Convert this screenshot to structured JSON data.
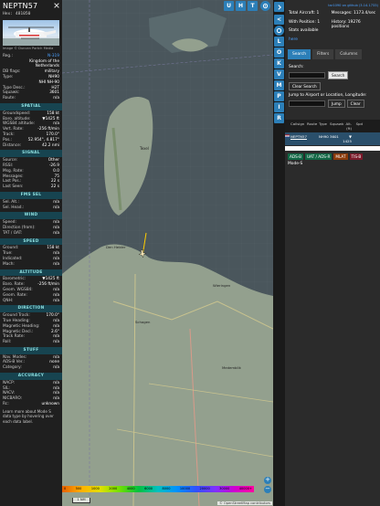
{
  "left": {
    "callsign": "NEPTN57",
    "hex_label": "Hex: 481050",
    "photo_credit": "Image © Duncan Portch Media",
    "rows1": [
      {
        "k": "Reg.:",
        "v": "N-319",
        "link": true
      },
      {
        "k": "",
        "v": "Kingdom of the Netherlands",
        "link": false
      },
      {
        "k": "DB flags:",
        "v": "military",
        "link": false
      },
      {
        "k": "Type:",
        "v": "NH90",
        "link": false
      },
      {
        "k": "",
        "v": "NHI NH-90",
        "link": false
      },
      {
        "k": "Type Desc.:",
        "v": "H2T",
        "link": false
      },
      {
        "k": "Squawk:",
        "v": "3601",
        "link": false
      },
      {
        "k": "Route:",
        "v": "n/a",
        "link": false
      }
    ],
    "sections": [
      {
        "title": "SPATIAL",
        "rows": [
          {
            "k": "Groundspeed:",
            "v": "158 kt"
          },
          {
            "k": "Baro. altitude:",
            "v": "▼1425 ft"
          },
          {
            "k": "WGS84 altitude:",
            "v": "n/a"
          },
          {
            "k": "Vert. Rate:",
            "v": "-256 ft/min"
          },
          {
            "k": "Track:",
            "v": "170.0°"
          },
          {
            "k": "Pos.:",
            "v": "52.954°, 4.817°"
          },
          {
            "k": "Distance:",
            "v": "42.2 nmi"
          }
        ]
      },
      {
        "title": "SIGNAL",
        "rows": [
          {
            "k": "Source:",
            "v": "Other"
          },
          {
            "k": "RSSI:",
            "v": "-26.9"
          },
          {
            "k": "Msg. Rate:",
            "v": "0.0"
          },
          {
            "k": "Messages:",
            "v": "75"
          },
          {
            "k": "Last Pos.:",
            "v": "22 s"
          },
          {
            "k": "Last Seen:",
            "v": "22 s"
          }
        ]
      },
      {
        "title": "FMS SEL",
        "rows": [
          {
            "k": "Sel. Alt.:",
            "v": "n/a"
          },
          {
            "k": "Sel. Head.:",
            "v": "n/a"
          }
        ]
      },
      {
        "title": "WIND",
        "rows": [
          {
            "k": "Speed:",
            "v": "n/a"
          },
          {
            "k": "Direction (from):",
            "v": "n/a"
          },
          {
            "k": "TAT / OAT:",
            "v": "n/a"
          }
        ]
      },
      {
        "title": "SPEED",
        "rows": [
          {
            "k": "Ground:",
            "v": "158 kt"
          },
          {
            "k": "True:",
            "v": "n/a"
          },
          {
            "k": "Indicated:",
            "v": "n/a"
          },
          {
            "k": "Mach:",
            "v": "n/a"
          }
        ]
      },
      {
        "title": "ALTITUDE",
        "rows": [
          {
            "k": "Barometric:",
            "v": "▼1425 ft"
          },
          {
            "k": "Baro. Rate:",
            "v": "-256 ft/min"
          },
          {
            "k": "Geom. WGS84:",
            "v": "n/a"
          },
          {
            "k": "Geom. Rate:",
            "v": "n/a"
          },
          {
            "k": "QNH:",
            "v": "n/a"
          }
        ]
      },
      {
        "title": "DIRECTION",
        "rows": [
          {
            "k": "Ground Track:",
            "v": "170.0°"
          },
          {
            "k": "True Heading:",
            "v": "n/a"
          },
          {
            "k": "Magnetic Heading:",
            "v": "n/a"
          },
          {
            "k": "Magnetic Decl.:",
            "v": "2.6°"
          },
          {
            "k": "Track Rate:",
            "v": "n/a"
          },
          {
            "k": "Roll:",
            "v": "n/a"
          }
        ]
      },
      {
        "title": "STUFF",
        "rows": [
          {
            "k": "Nav. Modes:",
            "v": "n/a"
          },
          {
            "k": "ADS-B Ver.:",
            "v": "none"
          },
          {
            "k": "Category:",
            "v": "n/a"
          }
        ]
      },
      {
        "title": "ACCURACY",
        "rows": [
          {
            "k": "NACP:",
            "v": "n/a"
          },
          {
            "k": "SIL:",
            "v": "n/a"
          },
          {
            "k": "NACV:",
            "v": "n/a"
          },
          {
            "k": "NICBARO:",
            "v": "n/a"
          },
          {
            "k": "Rc:",
            "v": "unknown"
          }
        ]
      }
    ],
    "note": "Learn more about Mode S data type by hovering over each data label."
  },
  "map": {
    "top_buttons": [
      "U",
      "H",
      "T"
    ],
    "places": [
      "Den Helder",
      "Texel",
      "Wieringen",
      "Schagen",
      "Medemblik"
    ],
    "zoom_in": "+",
    "zoom_out": "−",
    "scale_label": "1 NM",
    "attribution": "© OpenStreetMap contributors",
    "altitude_ticks": [
      "0",
      "500",
      "1000",
      "2000",
      "4000",
      "6000",
      "8000",
      "10000",
      "20000",
      "30000",
      "40000+"
    ]
  },
  "strip": {
    "buttons": [
      "<",
      "L",
      "O",
      "K",
      "V",
      "M",
      "P",
      "I",
      "R"
    ]
  },
  "right": {
    "top_link": "tar1090 on github (3.14.1733)",
    "total_label": "Total Aircraft: 1",
    "position_label": "With Position: 1",
    "stats_label": "Stats available",
    "stats_link": "here",
    "messages_label": "Messages: 1173.4/sec",
    "history_label": "History: 19276 positions",
    "tabs": [
      "Search",
      "Filters",
      "Columns"
    ],
    "search_label": "Search:",
    "search_button": "Search",
    "clear_search": "Clear Search",
    "jump_label": "Jump to Airport or Location, Longitude:",
    "jump_button": "Jump",
    "clear_button": "Clear",
    "table_headers": [
      "Callsign",
      "Route",
      "Type",
      "Squawk",
      "Alt.(ft)",
      "Spd"
    ],
    "table_row": {
      "callsign": "NEPTN57",
      "type": "NH90",
      "squawk": "3601",
      "alt": "▼ 1425"
    },
    "badges": [
      "ADS-B",
      "UAT / ADS-R",
      "MLAT",
      "TIS-B"
    ],
    "modes_label": "Mode-S"
  }
}
